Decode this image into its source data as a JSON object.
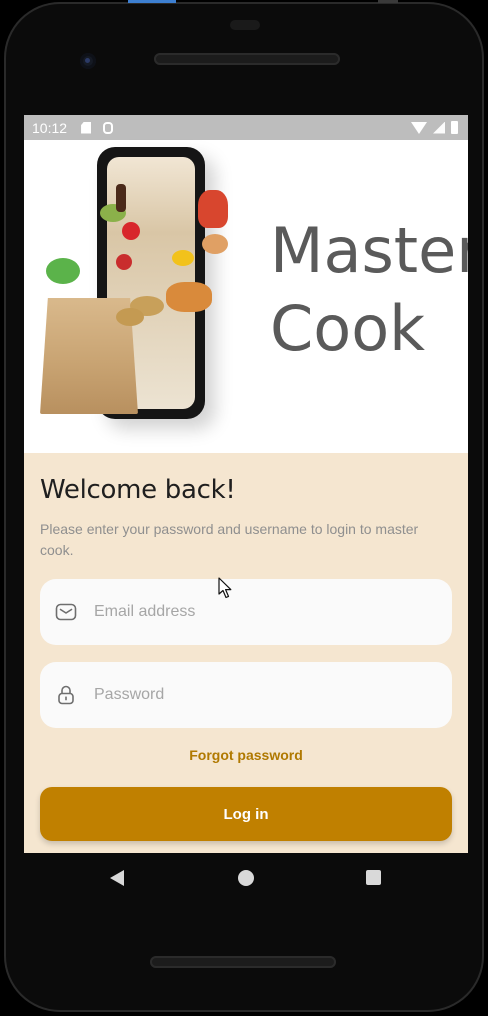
{
  "status_bar": {
    "time": "10:12",
    "icons": [
      "sd-card-icon",
      "app-notification-icon",
      "wifi-icon",
      "cell-signal-icon",
      "battery-icon"
    ]
  },
  "hero": {
    "title_line1": "Master",
    "title_line2": "Cook"
  },
  "login": {
    "title": "Welcome back!",
    "subtitle": "Please enter your password and username to login to master cook.",
    "email_placeholder": "Email address",
    "password_placeholder": "Password",
    "forgot_label": "Forgot password",
    "login_label": "Log in"
  },
  "colors": {
    "background": "#f5e6d0",
    "accent": "#c08000",
    "link": "#b07900",
    "field": "#fafafa"
  }
}
